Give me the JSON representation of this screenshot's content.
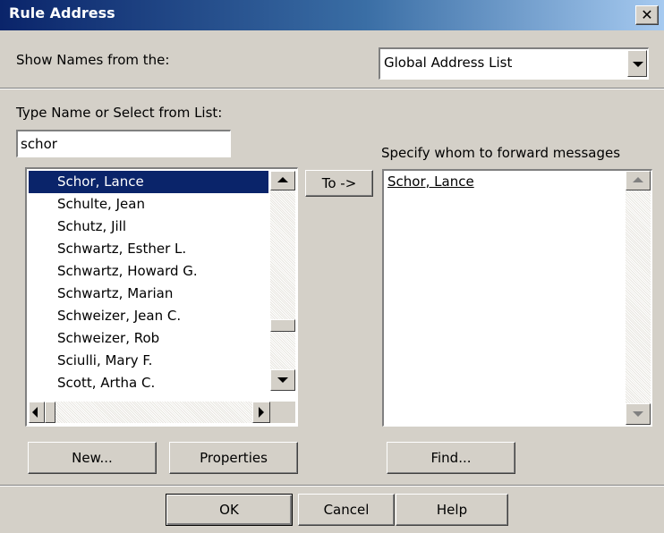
{
  "dialog": {
    "title": "Rule Address"
  },
  "show_names": {
    "label": "Show Names from the:",
    "selected": "Global Address List"
  },
  "type_name": {
    "label": "Type Name or Select from List:",
    "value": "schor"
  },
  "name_list": [
    "Schor, Lance",
    "Schulte, Jean",
    "Schutz, Jill",
    "Schwartz, Esther L.",
    "Schwartz, Howard G.",
    "Schwartz, Marian",
    "Schweizer, Jean C.",
    "Schweizer, Rob",
    "Sciulli, Mary F.",
    "Scott, Artha C."
  ],
  "selected_index": 0,
  "to_button": "To ->",
  "forward": {
    "label": "Specify whom to forward messages",
    "recipients": "Schor, Lance"
  },
  "buttons": {
    "new": "New...",
    "properties": "Properties",
    "find": "Find...",
    "ok": "OK",
    "cancel": "Cancel",
    "help": "Help"
  },
  "icons": {
    "close": "close-icon",
    "dropdown": "chevron-down-icon"
  },
  "colors": {
    "titlebar": "#0a246a",
    "selection": "#0a246a",
    "dialog_bg": "#d4d0c8"
  }
}
